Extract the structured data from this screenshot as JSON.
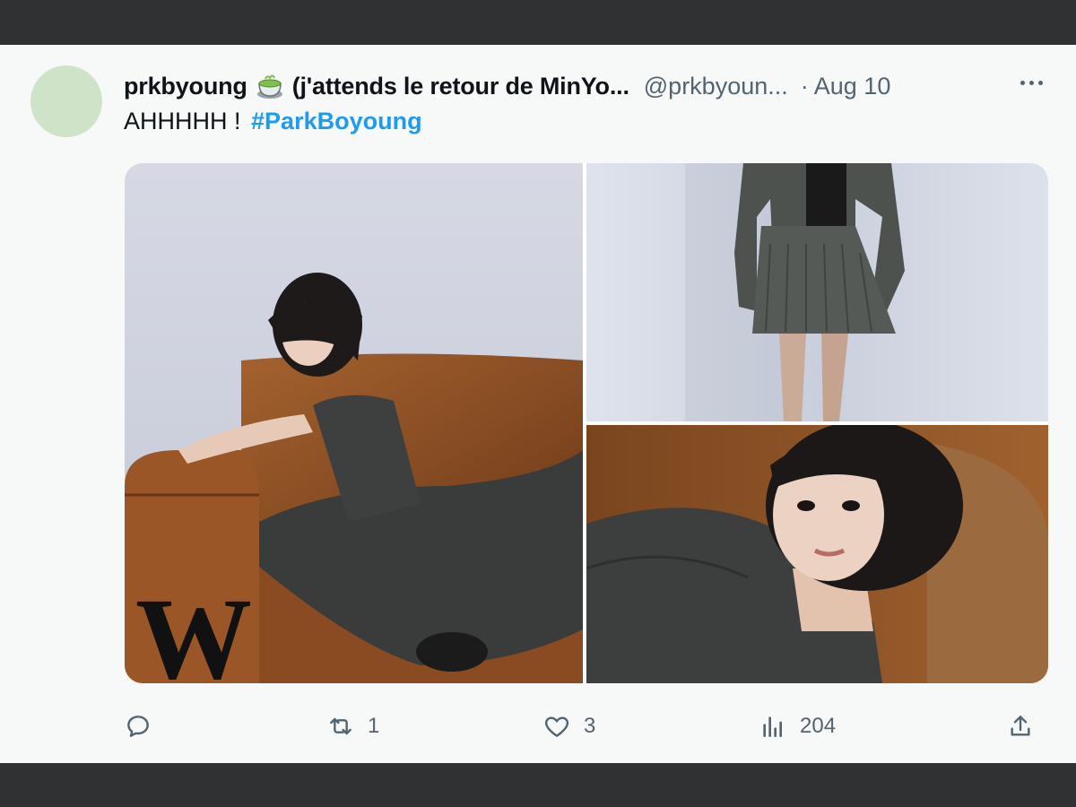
{
  "tweet": {
    "display_name": "prkbyoung",
    "display_name_suffix": "(j'attends le retour de MinYo...",
    "handle": "@prkbyoun...",
    "separator": "·",
    "date": "Aug 10",
    "text": "AHHHHH !",
    "hashtag": "#ParkBoyoung",
    "emoji_icon": "matcha-cup-icon",
    "watermark": "W"
  },
  "actions": {
    "reply_count": "",
    "retweet_count": "1",
    "like_count": "3",
    "views_count": "204"
  },
  "colors": {
    "accent": "#1d9bf0",
    "text_primary": "#0f1419",
    "text_secondary": "#536471",
    "frame": "#2f3133"
  }
}
